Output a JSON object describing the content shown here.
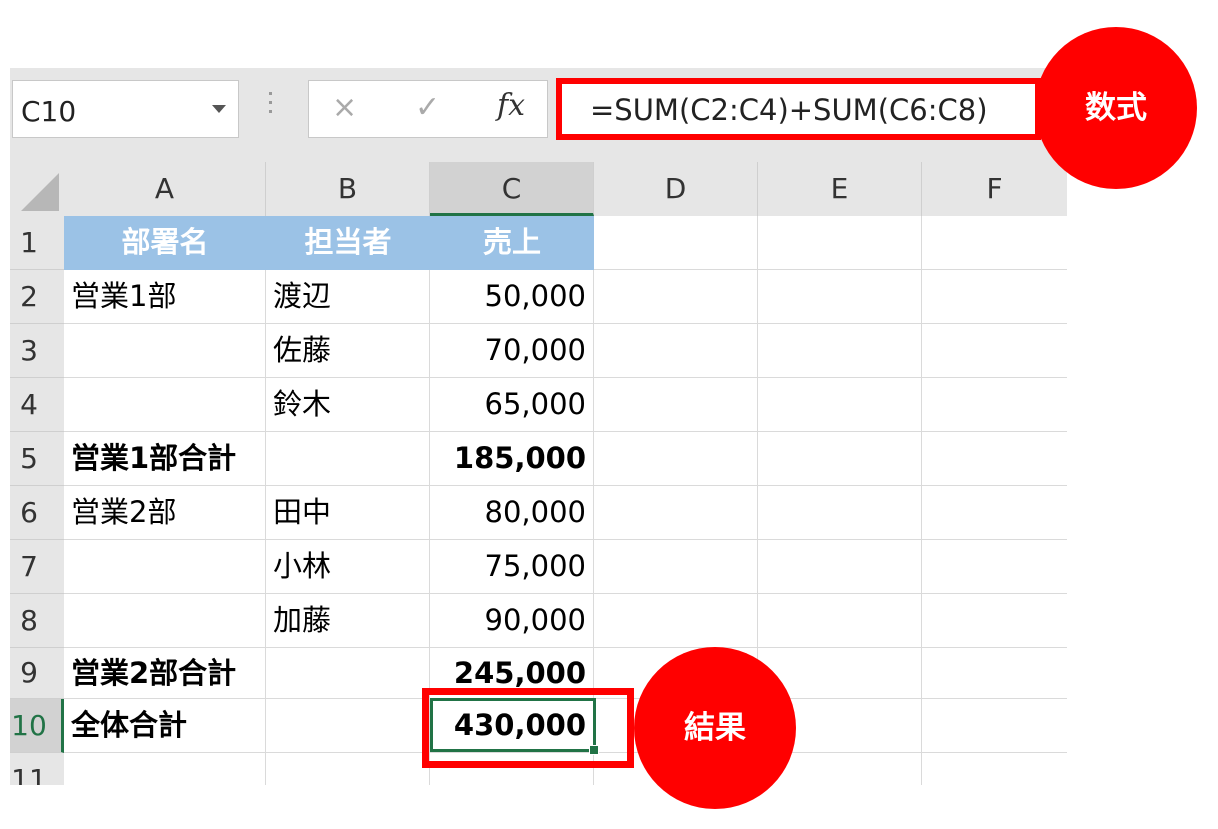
{
  "formula_bar": {
    "name_box": "C10",
    "cancel_icon": "×",
    "enter_icon": "✓",
    "fx_label": "fx",
    "formula": "=SUM(C2:C4)+SUM(C6:C8)"
  },
  "columns": [
    "A",
    "B",
    "C",
    "D",
    "E",
    "F"
  ],
  "rows": [
    "1",
    "2",
    "3",
    "4",
    "5",
    "6",
    "7",
    "8",
    "9",
    "10",
    "11"
  ],
  "header": {
    "a": "部署名",
    "b": "担当者",
    "c": "売上"
  },
  "data": [
    {
      "a": "営業1部",
      "b": "渡辺",
      "c": "50,000"
    },
    {
      "a": "",
      "b": "佐藤",
      "c": "70,000"
    },
    {
      "a": "",
      "b": "鈴木",
      "c": "65,000"
    },
    {
      "a": "営業1部合計",
      "b": "",
      "c": "185,000"
    },
    {
      "a": "営業2部",
      "b": "田中",
      "c": "80,000"
    },
    {
      "a": "",
      "b": "小林",
      "c": "75,000"
    },
    {
      "a": "",
      "b": "加藤",
      "c": "90,000"
    },
    {
      "a": "営業2部合計",
      "b": "",
      "c": "245,000"
    },
    {
      "a": "全体合計",
      "b": "",
      "c": "430,000"
    }
  ],
  "callouts": {
    "formula": "数式",
    "result": "結果"
  },
  "colors": {
    "highlight": "#ff0000",
    "header_fill": "#9bc2e6",
    "selection": "#217346"
  }
}
